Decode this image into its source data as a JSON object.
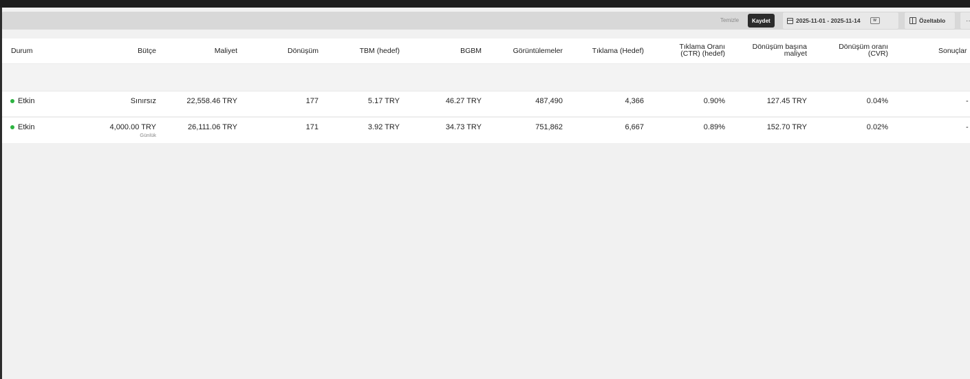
{
  "toolbar": {
    "clear_label": "Temizle",
    "save_label": "Kaydet",
    "date_range": "2025-11-01 - 2025-11-14",
    "mini_tag": "W",
    "custom_table_label": "Özeltablo",
    "more_label": "···"
  },
  "table": {
    "headers": {
      "status": "Durum",
      "budget": "Bütçe",
      "cost": "Maliyet",
      "conversion": "Dönüşüm",
      "cpc_target": "TBM (hedef)",
      "cpm": "BGBM",
      "impressions": "Görüntülemeler",
      "clicks_target": "Tıklama (Hedef)",
      "ctr_line1": "Tıklama Oranı",
      "ctr_line2": "(CTR) (hedef)",
      "cpa_line1": "Dönüşüm başına",
      "cpa_line2": "maliyet",
      "cvr_line1": "Dönüşüm oranı",
      "cvr_line2": "(CVR)",
      "results": "Sonuçlar"
    },
    "rows": [
      {
        "status": "Etkin",
        "budget": "Sınırsız",
        "budget_sub": "",
        "cost": "22,558.46 TRY",
        "conversion": "177",
        "cpc_target": "5.17 TRY",
        "cpm": "46.27 TRY",
        "impressions": "487,490",
        "clicks_target": "4,366",
        "ctr": "0.90%",
        "cpa": "127.45 TRY",
        "cvr": "0.04%",
        "results": "-"
      },
      {
        "status": "Etkin",
        "budget": "4,000.00 TRY",
        "budget_sub": "Günlük",
        "cost": "26,111.06 TRY",
        "conversion": "171",
        "cpc_target": "3.92 TRY",
        "cpm": "34.73 TRY",
        "impressions": "751,862",
        "clicks_target": "6,667",
        "ctr": "0.89%",
        "cpa": "152.70 TRY",
        "cvr": "0.02%",
        "results": "-"
      }
    ]
  },
  "colors": {
    "status_active": "#2db341",
    "save_button_bg": "#2b2b2b"
  }
}
